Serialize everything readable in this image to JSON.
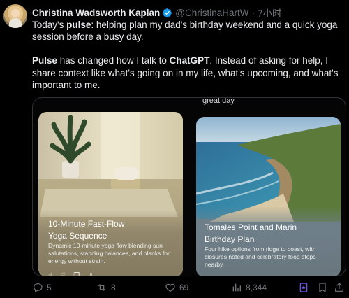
{
  "author": {
    "name": "Christina Wadsworth Kaplan",
    "handle": "@ChristinaHartW",
    "separator": "·",
    "time": "7小时"
  },
  "tweet": {
    "p1_before": "Today's ",
    "p1_bold": "pulse",
    "p1_after": ": helping plan my dad's birthday weekend and a quick yoga session before a busy day.",
    "p2_bold1": "Pulse",
    "p2_mid": " has changed how I talk to ",
    "p2_bold2": "ChatGPT",
    "p2_after": ". Instead of asking for help, I share context like what's going on in my life, what's upcoming, and what's important to me."
  },
  "media": {
    "top_caption": "great day",
    "card1": {
      "title_line1": "10-Minute Fast-Flow",
      "title_line2": "Yoga Sequence",
      "desc": "Dynamic 10-minute yoga flow blending sun salutations, standing balances, and planks for energy without strain."
    },
    "card2": {
      "title_line1": "Tomales Point and Marin",
      "title_line2": "Birthday Plan",
      "desc": "Four hike options from ridge to coast, with closures noted and celebratory food stops nearby."
    }
  },
  "actions": {
    "replies": "5",
    "reposts": "8",
    "likes": "69",
    "views": "8,344"
  },
  "colors": {
    "accent": "#1d9bf0",
    "bookmark_active": "#7856ff",
    "muted": "#71767b"
  }
}
